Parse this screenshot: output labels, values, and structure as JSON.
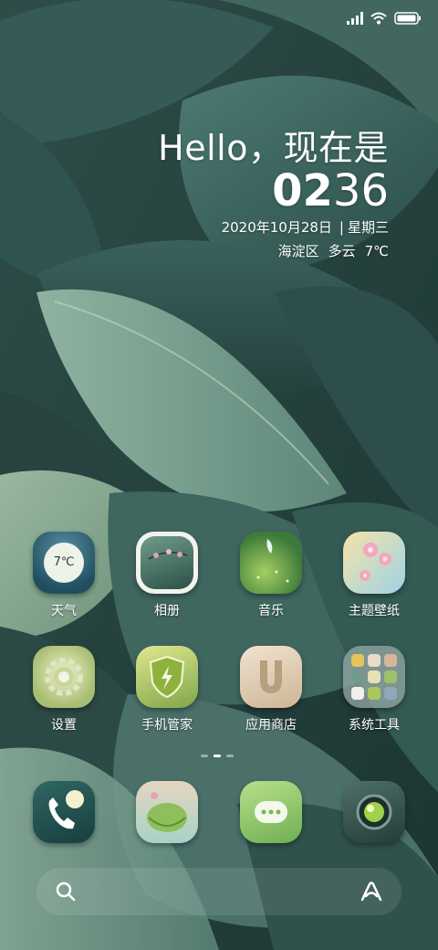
{
  "status_bar": {
    "icons": [
      "signal-icon",
      "wifi-icon",
      "battery-icon"
    ]
  },
  "clock_widget": {
    "greeting": "Hello，现在是",
    "hour": "02",
    "minute": "36",
    "date": "2020年10月28日",
    "separator": "|",
    "weekday": "星期三",
    "location": "海淀区",
    "condition": "多云",
    "temperature": "7℃"
  },
  "apps": [
    {
      "label": "天气",
      "icon": "weather-icon",
      "badge_text": "7℃"
    },
    {
      "label": "相册",
      "icon": "gallery-icon"
    },
    {
      "label": "音乐",
      "icon": "music-icon"
    },
    {
      "label": "主题壁纸",
      "icon": "themes-icon"
    },
    {
      "label": "设置",
      "icon": "settings-icon"
    },
    {
      "label": "手机管家",
      "icon": "security-icon"
    },
    {
      "label": "应用商店",
      "icon": "app-store-icon"
    },
    {
      "label": "系统工具",
      "icon": "tools-folder-icon"
    }
  ],
  "page_indicator": {
    "pages": 3,
    "current": 2
  },
  "dock": [
    {
      "icon": "phone-icon"
    },
    {
      "icon": "browser-icon"
    },
    {
      "icon": "messages-icon"
    },
    {
      "icon": "camera-icon"
    }
  ],
  "search_bar": {
    "left_icon": "search-icon",
    "right_icon": "assistant-icon"
  },
  "colors": {
    "leaf_dark": "#24413f",
    "leaf_mid": "#3f6a63",
    "leaf_light": "#7fa596",
    "text": "#ffffff"
  }
}
